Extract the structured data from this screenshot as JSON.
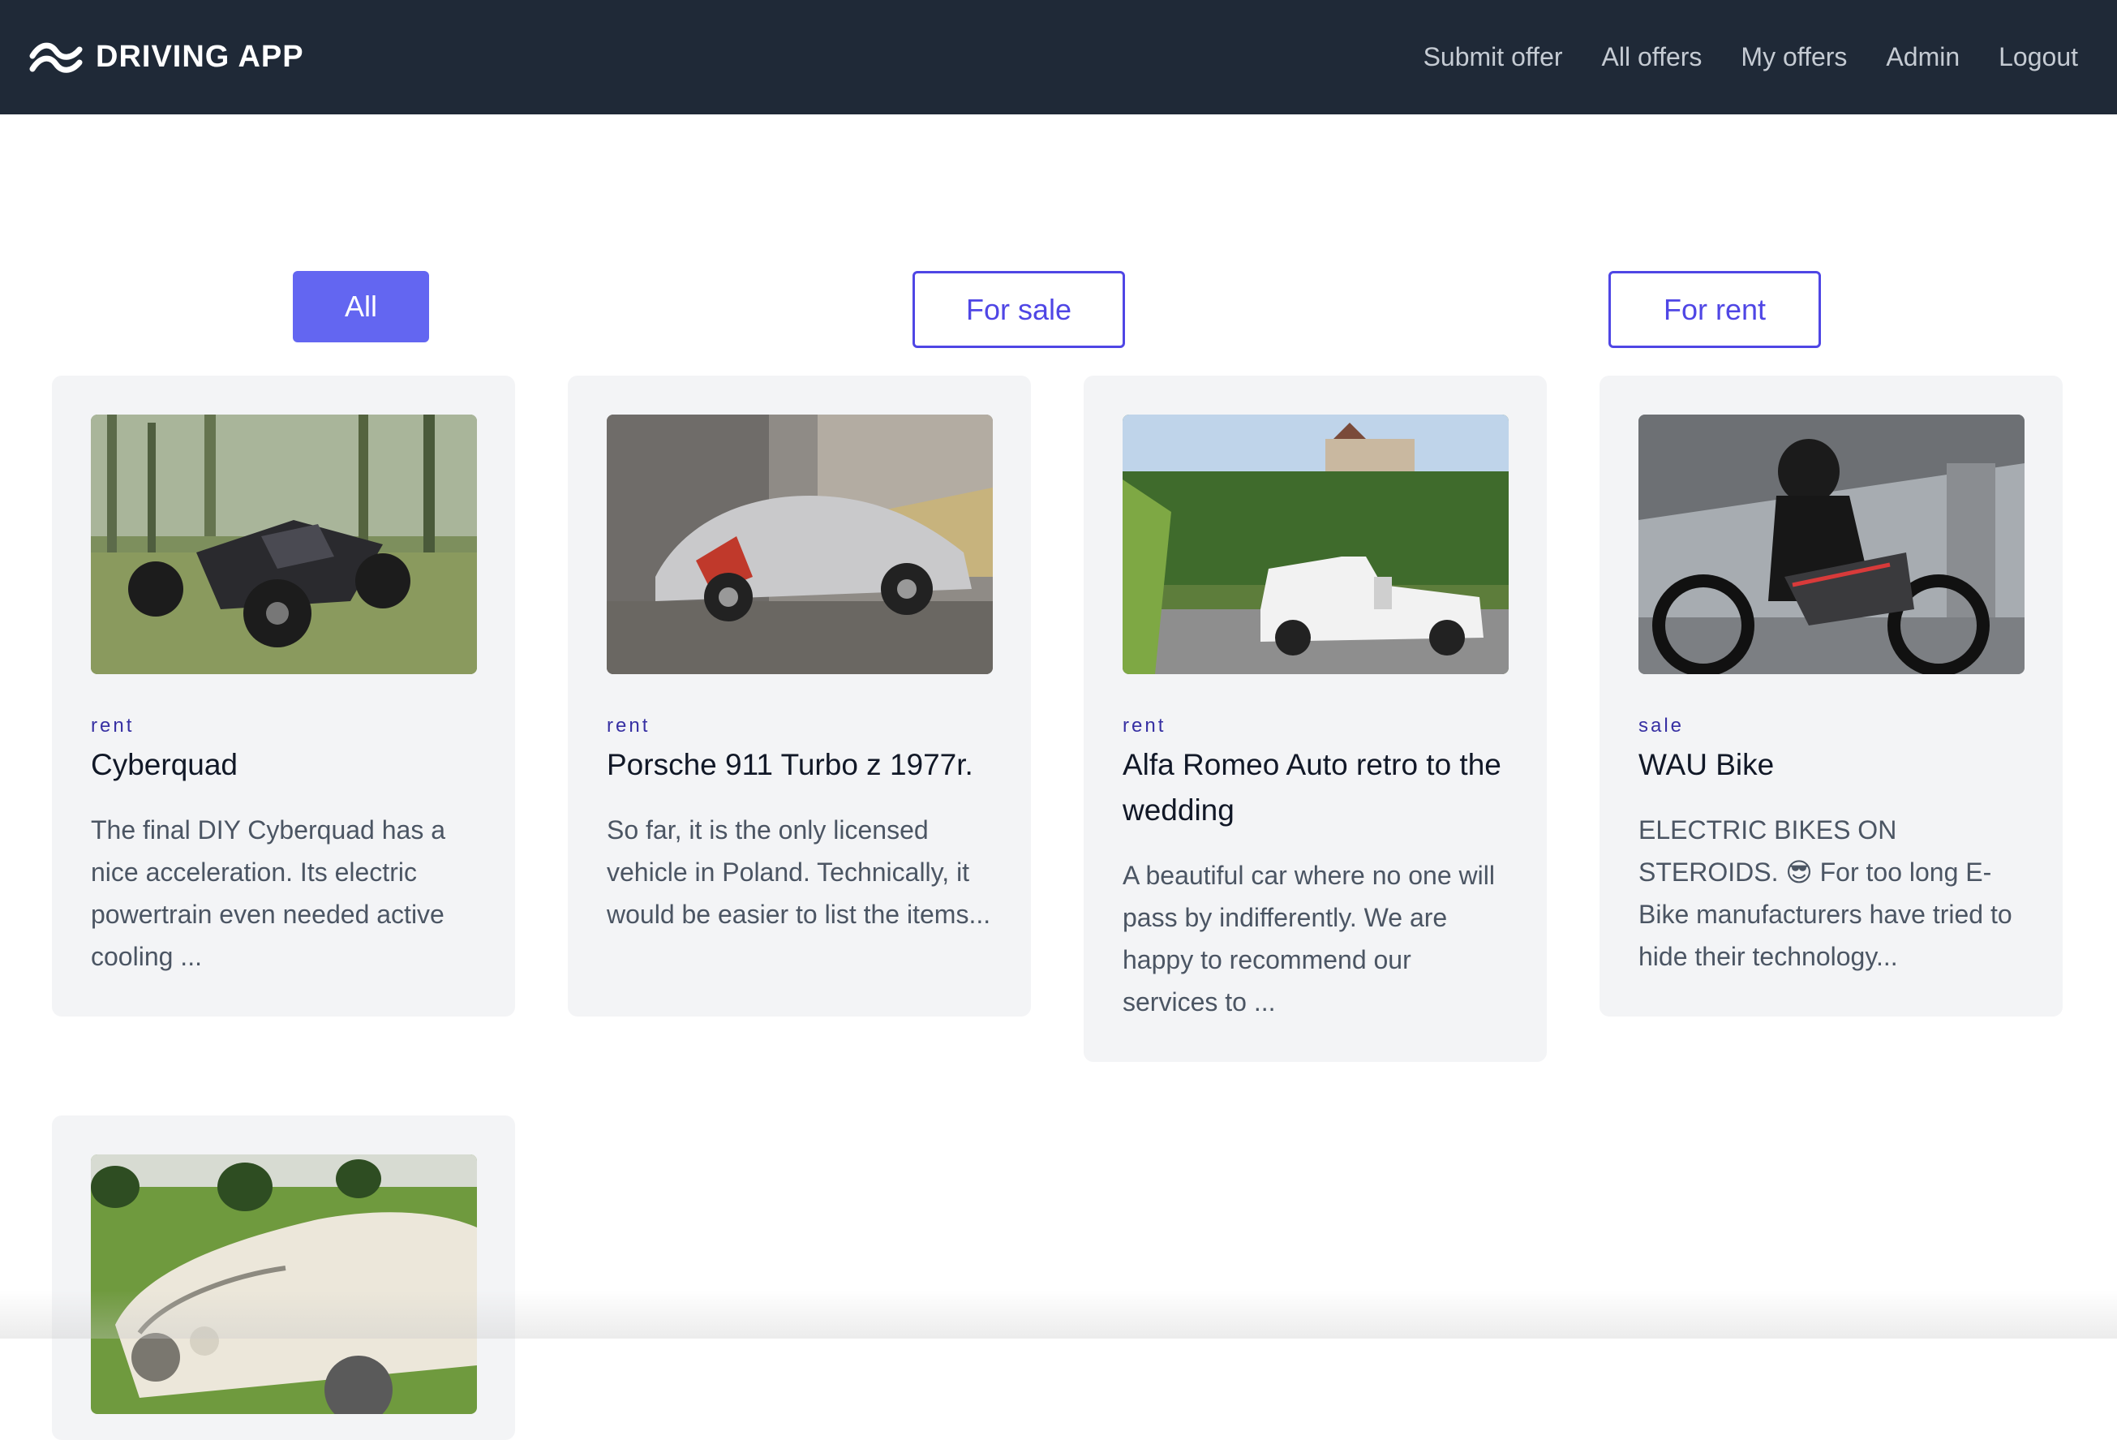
{
  "nav": {
    "brand": "DRIVING APP",
    "links": [
      "Submit offer",
      "All offers",
      "My offers",
      "Admin",
      "Logout"
    ]
  },
  "filters": {
    "all": "All",
    "for_sale": "For sale",
    "for_rent": "For rent"
  },
  "offers": [
    {
      "type": "rent",
      "title": "Cyberquad",
      "description": "The final DIY Cyberquad has a nice acceleration. Its electric powertrain even needed active cooling ...",
      "image": "quad-bike-photo"
    },
    {
      "type": "rent",
      "title": "Porsche 911 Turbo z 1977r.",
      "description": "So far, it is the only licensed vehicle in Poland. Technically, it would be easier to list the items...",
      "image": "porsche-photo"
    },
    {
      "type": "rent",
      "title": "Alfa Romeo Auto retro to the wedding",
      "description": "A beautiful car where no one will pass by indifferently. We are happy to recommend our services to ...",
      "image": "retro-car-photo"
    },
    {
      "type": "sale",
      "title": "WAU Bike",
      "description": "ELECTRIC BIKES ON STEROIDS. 😎 For too long E-Bike manufacturers have tried to hide their technology...",
      "image": "electric-bike-photo"
    },
    {
      "type": "",
      "title": "",
      "description": "",
      "image": "white-classic-car-photo"
    }
  ],
  "colors": {
    "navbar": "#1f2937",
    "accent": "#6366f1",
    "card_bg": "#f3f4f6"
  }
}
